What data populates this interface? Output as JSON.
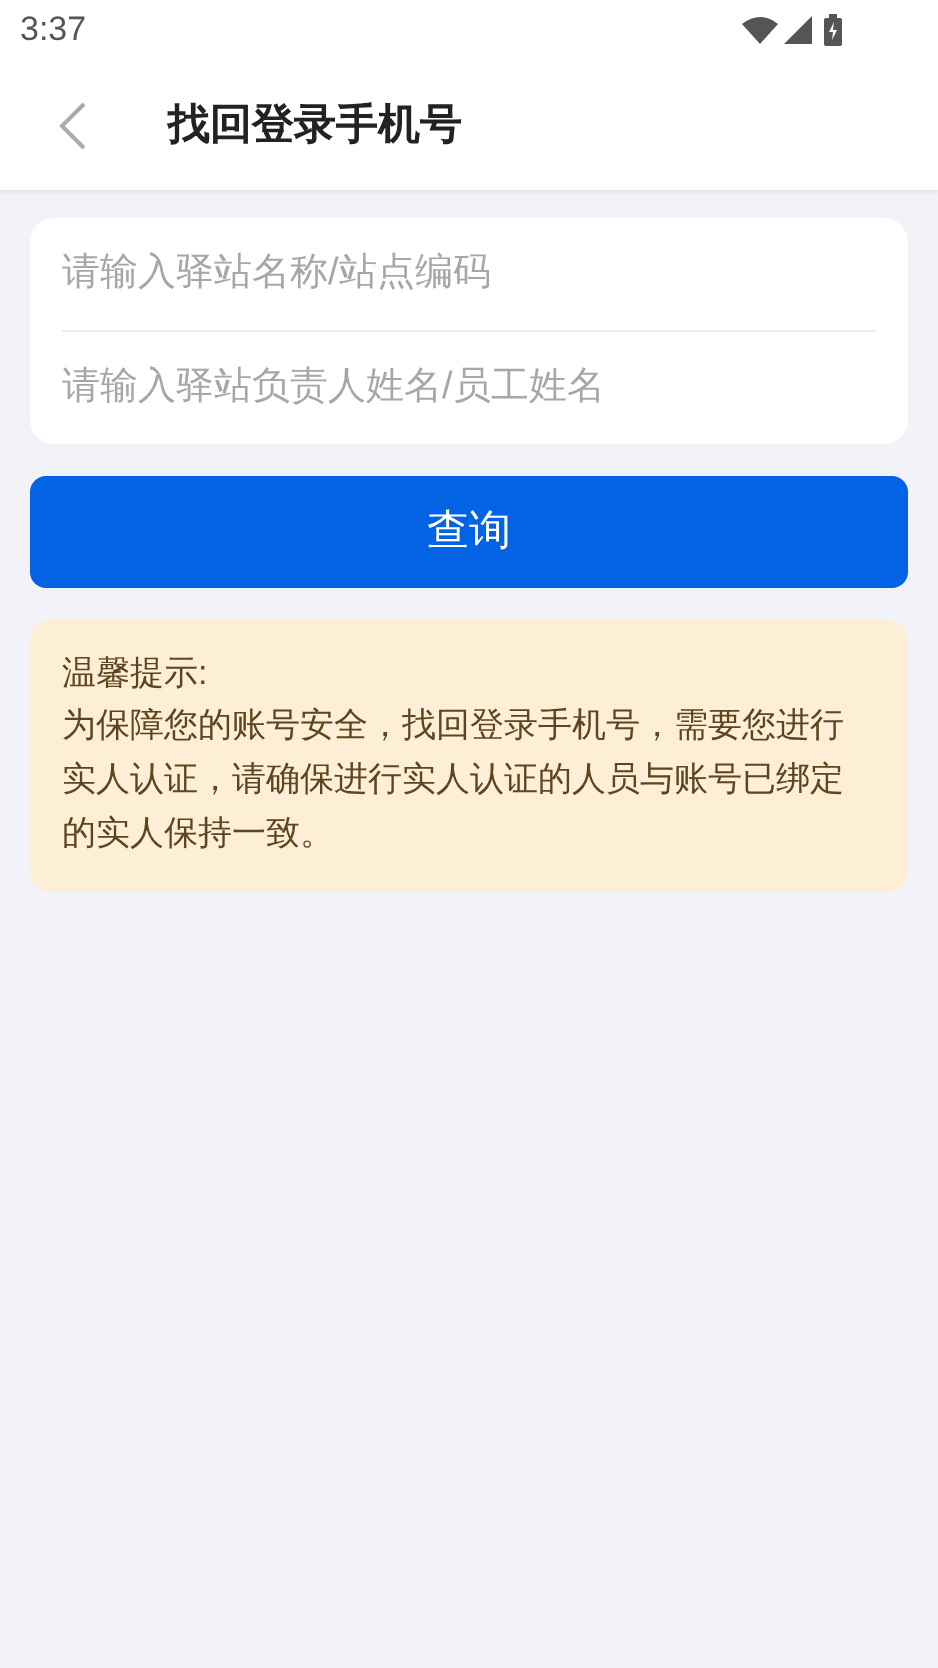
{
  "status_bar": {
    "time": "3:37"
  },
  "header": {
    "title": "找回登录手机号"
  },
  "form": {
    "fields": [
      {
        "placeholder": "请输入驿站名称/站点编码"
      },
      {
        "placeholder": "请输入驿站负责人姓名/员工姓名"
      }
    ]
  },
  "query_button": {
    "label": "查询"
  },
  "notice": {
    "title": "温馨提示:",
    "body": "为保障您的账号安全，找回登录手机号，需要您进行实人认证，请确保进行实人认证的人员与账号已绑定的实人保持一致。"
  }
}
